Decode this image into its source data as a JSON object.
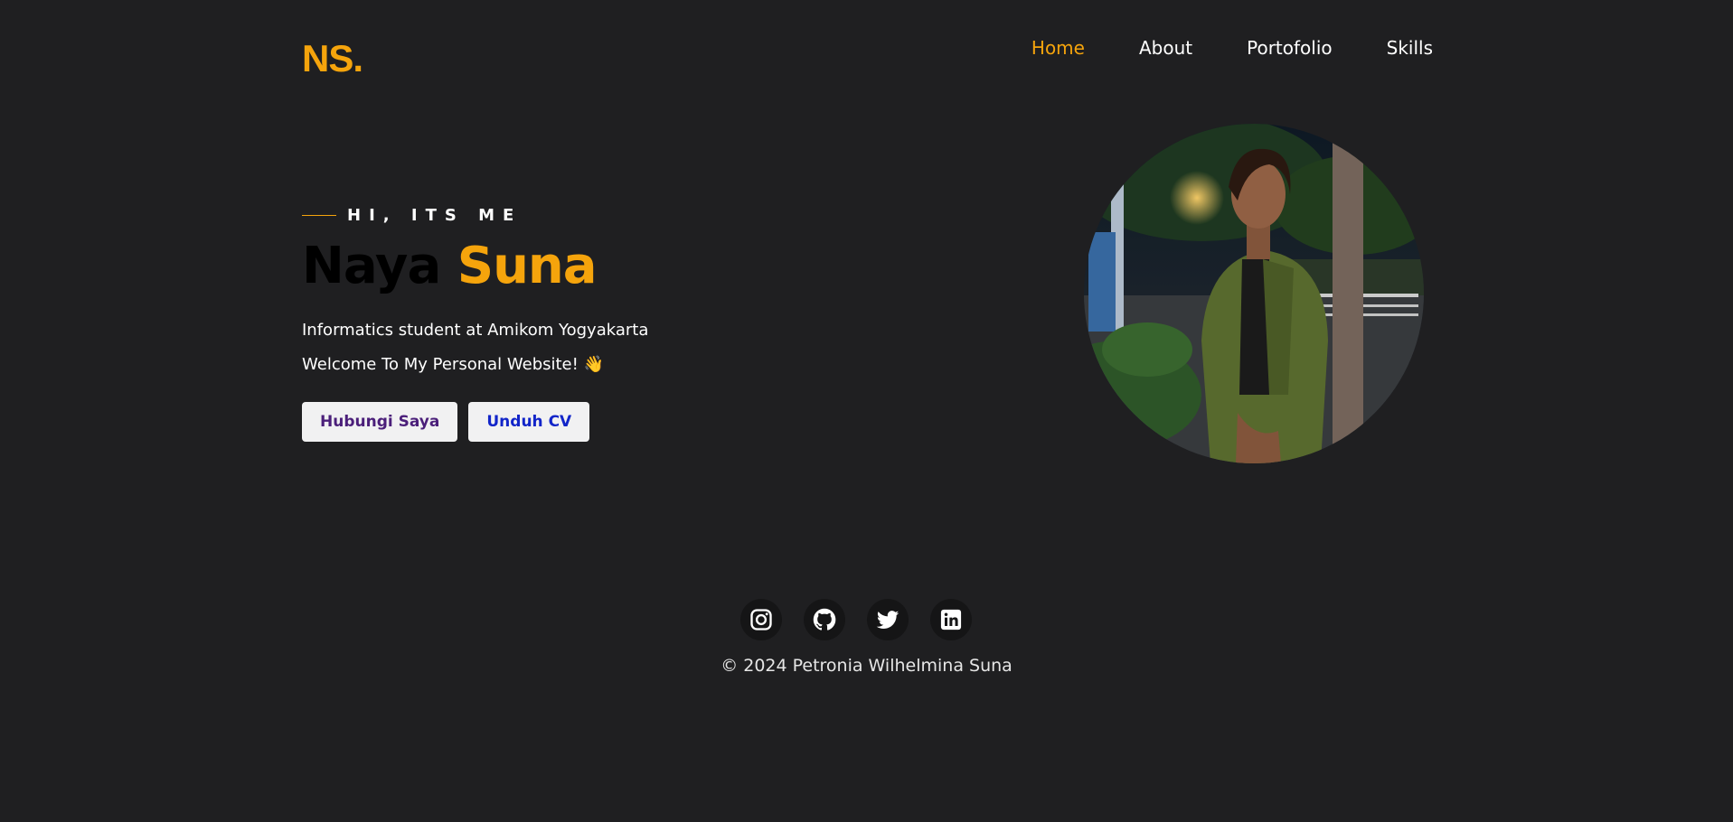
{
  "brand": {
    "logo": "NS.",
    "accent_color": "#f5a40c"
  },
  "nav": {
    "items": [
      {
        "label": "Home",
        "active": true
      },
      {
        "label": "About",
        "active": false
      },
      {
        "label": "Portofolio",
        "active": false
      },
      {
        "label": "Skills",
        "active": false
      }
    ]
  },
  "hero": {
    "eyebrow": "HI, ITS ME",
    "name_first": "Naya",
    "name_last": "Suna",
    "line1": "Informatics student at Amikom Yogyakarta",
    "line2": "Welcome To My Personal Website! 👋",
    "contact_button": "Hubungi Saya",
    "cv_button": "Unduh CV",
    "photo": "profile-photo"
  },
  "footer": {
    "social": [
      "instagram-icon",
      "github-icon",
      "twitter-icon",
      "linkedin-icon"
    ],
    "copyright": "© 2024 Petronia Wilhelmina Suna"
  }
}
